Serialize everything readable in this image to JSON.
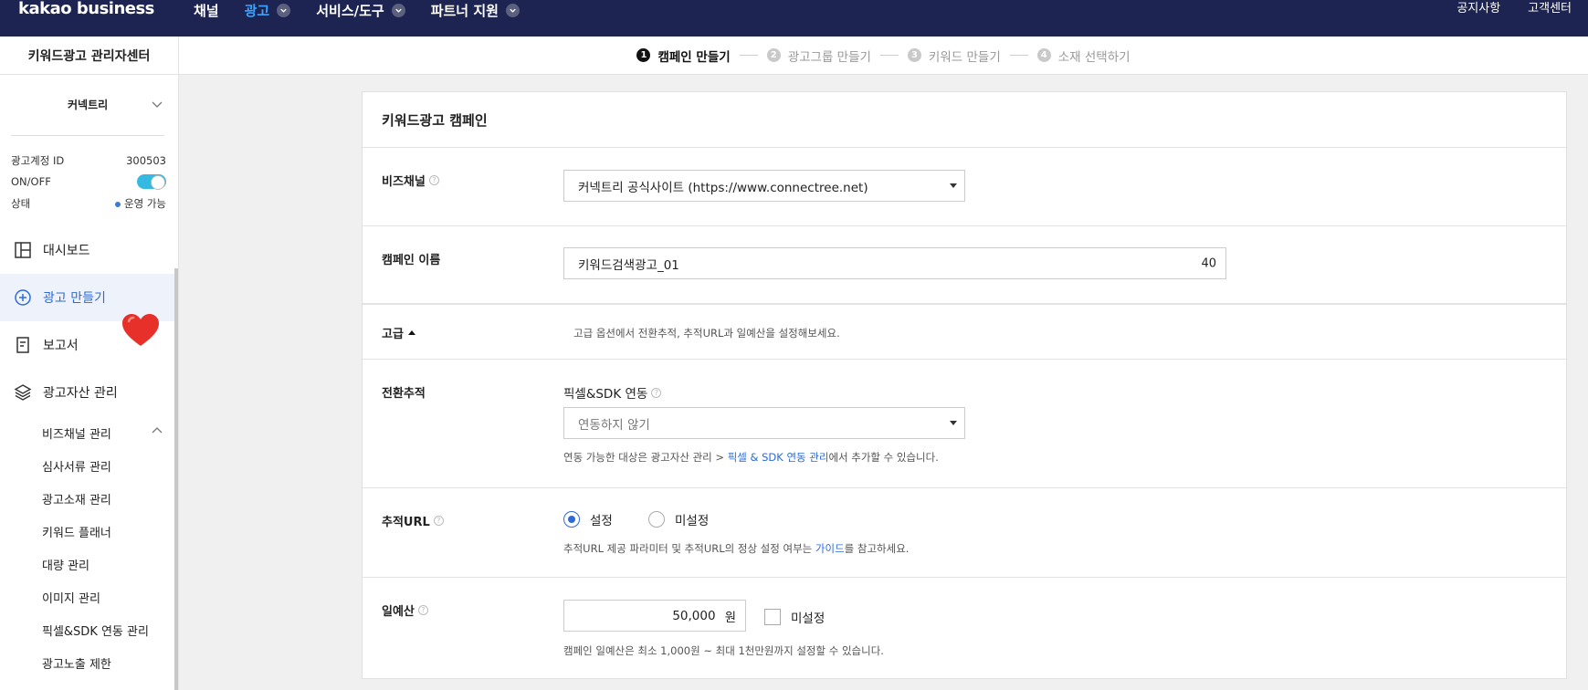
{
  "header": {
    "logo": "kakao business",
    "nav": [
      {
        "label": "채널",
        "dropdown": false,
        "active": false
      },
      {
        "label": "광고",
        "dropdown": true,
        "active": true
      },
      {
        "label": "서비스/도구",
        "dropdown": true,
        "active": false
      },
      {
        "label": "파트너 지원",
        "dropdown": true,
        "active": false
      }
    ],
    "right_links": [
      "공지사항",
      "고객센터"
    ]
  },
  "sidebar": {
    "title": "키워드광고 관리자센터",
    "account_name": "커넥트리",
    "info": {
      "id_label": "광고계정 ID",
      "id_value": "300503",
      "onoff_label": "ON/OFF",
      "status_label": "상태",
      "status_value": "운영 가능"
    },
    "menu": [
      {
        "label": "대시보드",
        "icon": "dashboard-icon"
      },
      {
        "label": "광고 만들기",
        "icon": "plus-circle-icon"
      },
      {
        "label": "보고서",
        "icon": "report-icon"
      },
      {
        "label": "광고자산 관리",
        "icon": "layers-icon"
      }
    ],
    "submenu": [
      "비즈채널 관리",
      "심사서류 관리",
      "광고소재 관리",
      "키워드 플래너",
      "대량 관리",
      "이미지 관리",
      "픽셀&SDK 연동 관리",
      "광고노출 제한"
    ]
  },
  "stepper": {
    "steps": [
      {
        "num": "1",
        "label": "캠페인 만들기"
      },
      {
        "num": "2",
        "label": "광고그룹 만들기"
      },
      {
        "num": "3",
        "label": "키워드 만들기"
      },
      {
        "num": "4",
        "label": "소재 선택하기"
      }
    ]
  },
  "form": {
    "title": "키워드광고 캠페인",
    "bizchannel": {
      "label": "비즈채널",
      "value": "커넥트리 공식사이트 (https://www.connectree.net)"
    },
    "campaign_name": {
      "label": "캠페인 이름",
      "value": "키워드검색광고_01",
      "counter": "40"
    },
    "advanced": {
      "label": "고급",
      "hint": "고급 옵션에서 전환추적, 추적URL과 일예산을 설정해보세요."
    },
    "conversion": {
      "label": "전환추적",
      "sublabel": "픽셀&SDK 연동",
      "select_value": "연동하지 않기",
      "hint_pre": "연동 가능한 대상은 광고자산 관리 > ",
      "hint_link": "픽셀 & SDK 연동 관리",
      "hint_post": "에서 추가할 수 있습니다."
    },
    "tracking_url": {
      "label": "추적URL",
      "option_on": "설정",
      "option_off": "미설정",
      "hint_pre": "추적URL 제공 파라미터 및 추적URL의 정상 설정 여부는 ",
      "hint_link": "가이드",
      "hint_post": "를 참고하세요."
    },
    "daily_budget": {
      "label": "일예산",
      "value": "50,000",
      "unit": "원",
      "unset_label": "미설정",
      "hint": "캠페인 일예산은 최소 1,000원 ~ 최대 1천만원까지 설정할 수 있습니다."
    }
  },
  "colors": {
    "header_bg": "#1d2451",
    "accent": "#2d6bd8",
    "toggle": "#35b9e0",
    "heart": "#e8302a"
  }
}
